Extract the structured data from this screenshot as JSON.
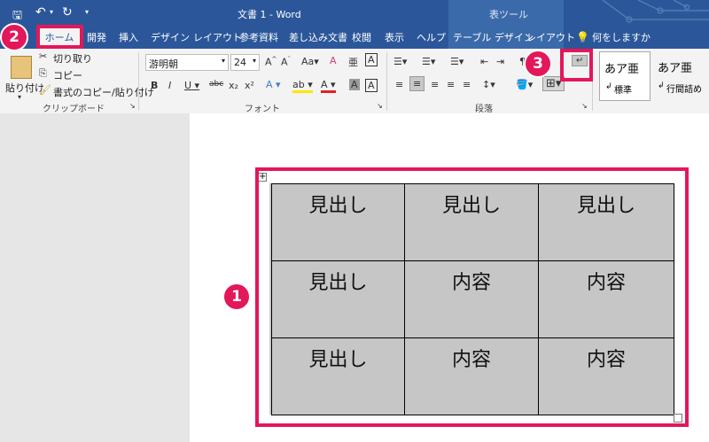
{
  "title_bar": {
    "doc_title": "文書 1 - Word",
    "context_group": "表ツール"
  },
  "tabs": [
    "ホーム",
    "開発",
    "挿入",
    "デザイン",
    "レイアウト",
    "参考資料",
    "差し込み文書",
    "校閲",
    "表示",
    "ヘルプ",
    "テーブル デザイン",
    "レイアウト"
  ],
  "tell_me": "何をしますか",
  "clipboard": {
    "paste": "貼り付け",
    "cut": "切り取り",
    "copy": "コピー",
    "format_painter": "書式のコピー/貼り付け",
    "label": "クリップボード"
  },
  "font": {
    "name": "游明朝",
    "size": "24",
    "label": "フォント"
  },
  "paragraph": {
    "label": "段落"
  },
  "styles": [
    {
      "preview": "あア亜",
      "name": "標準"
    },
    {
      "preview": "あア亜",
      "name": "行間詰め"
    }
  ],
  "table": {
    "rows": [
      [
        "見出し",
        "見出し",
        "見出し"
      ],
      [
        "見出し",
        "内容",
        "内容"
      ],
      [
        "見出し",
        "内容",
        "内容"
      ]
    ]
  },
  "callouts": {
    "one": "1",
    "two": "2",
    "three": "3"
  },
  "colors": {
    "accent": "#e3175a",
    "ribbon": "#2b579a",
    "cell": "#c6c6c6"
  }
}
